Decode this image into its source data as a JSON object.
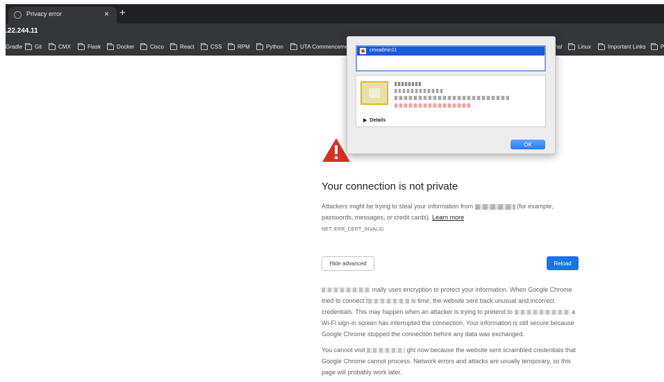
{
  "browser": {
    "tab_title": "Privacy error",
    "tab_close": "×",
    "new_tab": "+",
    "address": ".22.244.11"
  },
  "bookmarks": [
    "Gradle",
    "Git",
    "CMX",
    "Flask",
    "Docker",
    "Cisco",
    "React",
    "CSS",
    "RPM",
    "Python",
    "UTA Commenceme..."
  ],
  "bookmarks_right": [
    {
      "label": "orial",
      "folder": false
    },
    {
      "label": "Linux",
      "folder": true
    },
    {
      "label": "Important Links",
      "folder": true
    },
    {
      "label": "P",
      "folder": true
    }
  ],
  "page": {
    "heading": "Your connection is not private",
    "desc_prefix": "Attackers might be trying to steal your information from",
    "desc_suffix": "(for example, passwords, messages, or credit cards).",
    "learn_more": "Learn more",
    "error_code": "NET::ERR_CERT_INVALID",
    "hide_advanced": "Hide advanced",
    "reload": "Reload",
    "p1_a": "mally uses encryption to protect your information. When Google Chrome tried to connect t",
    "p1_b": "is time, the website sent back unusual and incorrect credentials. This may happen when an attacker is trying to pretend to",
    "p1_c": "a Wi-Fi sign-in screen has interrupted the connection. Your information is still secure because Google Chrome stopped the connection before any data was exchanged.",
    "p2_a": "You cannot visit",
    "p2_b": "ght now because the website sent scrambled credentials that Google Chrome cannot process. Network errors and attacks are usually temporary, so this page will probably work later."
  },
  "dialog": {
    "cert_name": "cmxadmin11",
    "details_label": "Details",
    "ok_label": "OK"
  },
  "colors": {
    "warning_red": "#d93025",
    "primary_blue": "#1a73e8",
    "selection_blue": "#1d5ad6"
  }
}
